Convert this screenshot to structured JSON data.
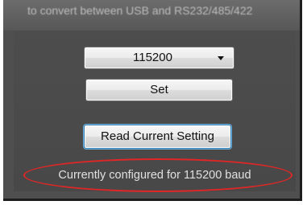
{
  "banner": {
    "text": "to convert between USB and RS232/485/422"
  },
  "baud_select": {
    "value": "115200"
  },
  "buttons": {
    "set": "Set",
    "read": "Read Current Setting"
  },
  "status": {
    "text": "Currently configured for 115200 baud"
  },
  "colors": {
    "highlight_oval": "#e02626",
    "panel": "#4d4d4d",
    "focus_border": "#3c7fb1"
  }
}
